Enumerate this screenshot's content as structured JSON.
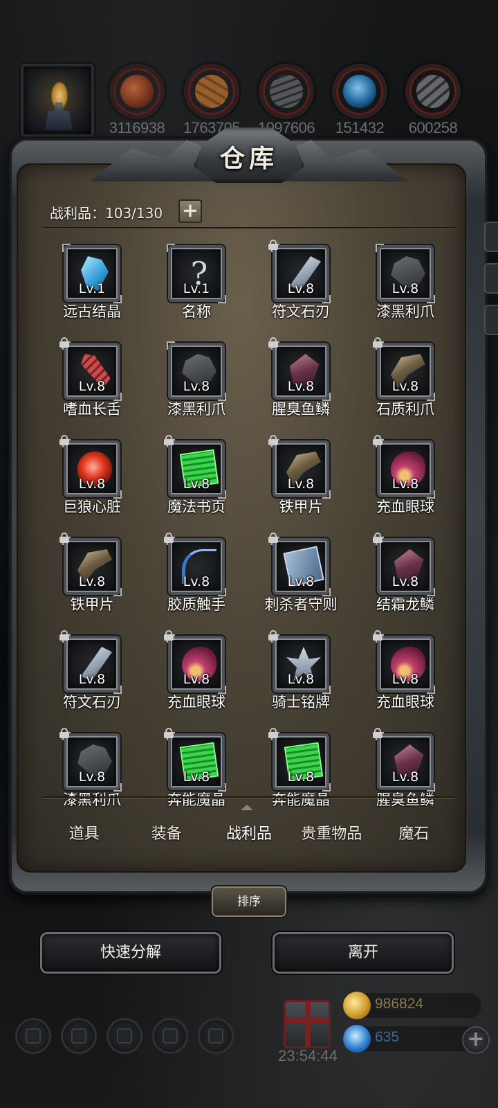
{
  "resources": [
    {
      "icon": "meat-icon",
      "cls": "meat",
      "value": "3116938"
    },
    {
      "icon": "wood-icon",
      "cls": "wood",
      "value": "1763705"
    },
    {
      "icon": "stone-icon",
      "cls": "stone",
      "value": "1097606"
    },
    {
      "icon": "crystal-icon",
      "cls": "crystal",
      "value": "151432"
    },
    {
      "icon": "iron-icon",
      "cls": "iron",
      "value": "600258"
    }
  ],
  "panel": {
    "title": "仓库",
    "loot_count": "战利品：103/130",
    "add_label": "+"
  },
  "items": [
    {
      "level": "Lv.1",
      "name": "远古结晶",
      "art": "crystal",
      "locked": false
    },
    {
      "level": "Lv.1",
      "name": "名称",
      "art": "unknown",
      "locked": false
    },
    {
      "level": "Lv.8",
      "name": "符文石刃",
      "art": "blade",
      "locked": true
    },
    {
      "level": "Lv.8",
      "name": "漆黑利爪",
      "art": "claw",
      "locked": false
    },
    {
      "level": "Lv.8",
      "name": "嗜血长舌",
      "art": "tongue",
      "locked": true
    },
    {
      "level": "Lv.8",
      "name": "漆黑利爪",
      "art": "claw",
      "locked": false
    },
    {
      "level": "Lv.8",
      "name": "腥臭鱼鳞",
      "art": "scale",
      "locked": true
    },
    {
      "level": "Lv.8",
      "name": "石质利爪",
      "art": "stoneclaw",
      "locked": true
    },
    {
      "level": "Lv.8",
      "name": "巨狼心脏",
      "art": "heart",
      "locked": true
    },
    {
      "level": "Lv.8",
      "name": "魔法书页",
      "art": "page",
      "locked": true
    },
    {
      "level": "Lv.8",
      "name": "铁甲片",
      "art": "stoneclaw",
      "locked": true
    },
    {
      "level": "Lv.8",
      "name": "充血眼球",
      "art": "eye",
      "locked": true
    },
    {
      "level": "Lv.8",
      "name": "铁甲片",
      "art": "stoneclaw",
      "locked": true
    },
    {
      "level": "Lv.8",
      "name": "胶质触手",
      "art": "tentacle",
      "locked": true
    },
    {
      "level": "Lv.8",
      "name": "刺杀者守则",
      "art": "book",
      "locked": true
    },
    {
      "level": "Lv.8",
      "name": "结霜龙鳞",
      "art": "scale",
      "locked": true
    },
    {
      "level": "Lv.8",
      "name": "符文石刃",
      "art": "blade",
      "locked": true
    },
    {
      "level": "Lv.8",
      "name": "充血眼球",
      "art": "eye",
      "locked": true
    },
    {
      "level": "Lv.8",
      "name": "骑士铭牌",
      "art": "badge",
      "locked": true
    },
    {
      "level": "Lv.8",
      "name": "充血眼球",
      "art": "eye",
      "locked": true
    },
    {
      "level": "Lv.8",
      "name": "漆黑利爪",
      "art": "claw",
      "locked": true
    },
    {
      "level": "Lv.8",
      "name": "奔能魔晶",
      "art": "page",
      "locked": true
    },
    {
      "level": "Lv.8",
      "name": "奔能魔晶",
      "art": "page",
      "locked": true
    },
    {
      "level": "Lv.8",
      "name": "腥臭鱼鳞",
      "art": "scale",
      "locked": true
    }
  ],
  "tabs": [
    {
      "label": "道具",
      "active": false
    },
    {
      "label": "装备",
      "active": false
    },
    {
      "label": "战利品",
      "active": true
    },
    {
      "label": "贵重物品",
      "active": false
    },
    {
      "label": "魔石",
      "active": false
    }
  ],
  "actions": {
    "sort": "排序",
    "quick_decompose": "快速分解",
    "leave": "离开"
  },
  "hud": {
    "timer": "23:54:44",
    "gold": "986824",
    "gems": "635",
    "gold_color": "#8a7a4a",
    "gem_color": "#3a6a9a"
  }
}
